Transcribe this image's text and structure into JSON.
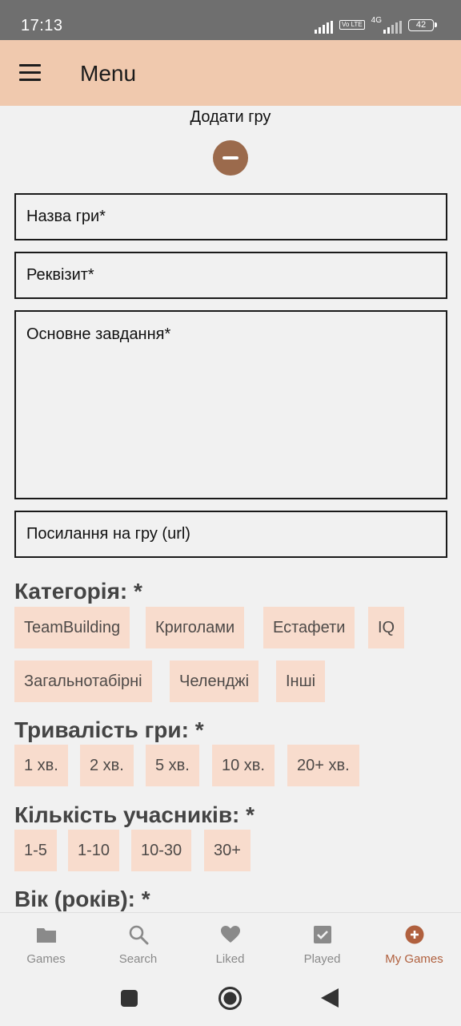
{
  "status_bar": {
    "time": "17:13",
    "network": "4G",
    "volte": "Vo LTE",
    "battery": "42"
  },
  "app_bar": {
    "title": "Menu",
    "menu_icon": "hamburger-icon"
  },
  "form": {
    "heading": "Додати гру",
    "collapse_icon": "minus-circle-icon",
    "fields": {
      "name": "Назва гри*",
      "props": "Реквізит*",
      "task": "Основне завдання*",
      "url": "Посилання на гру (url)"
    }
  },
  "sections": {
    "category": {
      "title": "Категорія: *",
      "options": [
        "TeamBuilding",
        "Криголами",
        "Естафети",
        "IQ",
        "Загальнотабірні",
        "Челенджі",
        "Інші"
      ]
    },
    "duration": {
      "title": "Тривалість гри: *",
      "options": [
        "1 хв.",
        "2 хв.",
        "5 хв.",
        "10 хв.",
        "20+ хв."
      ]
    },
    "participants": {
      "title": "Кількість учасників: *",
      "options": [
        "1-5",
        "1-10",
        "10-30",
        "30+"
      ]
    },
    "age": {
      "title": "Вік (років): *"
    }
  },
  "bottom_nav": [
    {
      "label": "Games",
      "icon": "folder-icon",
      "active": false
    },
    {
      "label": "Search",
      "icon": "search-icon",
      "active": false
    },
    {
      "label": "Liked",
      "icon": "heart-icon",
      "active": false
    },
    {
      "label": "Played",
      "icon": "checkbox-icon",
      "active": false
    },
    {
      "label": "My Games",
      "icon": "add-circle-icon",
      "active": true
    }
  ],
  "colors": {
    "app_bar": "#f0c9ae",
    "accent": "#9b6a4c",
    "chip_bg": "#f8dccd",
    "active_nav": "#b0603e"
  }
}
